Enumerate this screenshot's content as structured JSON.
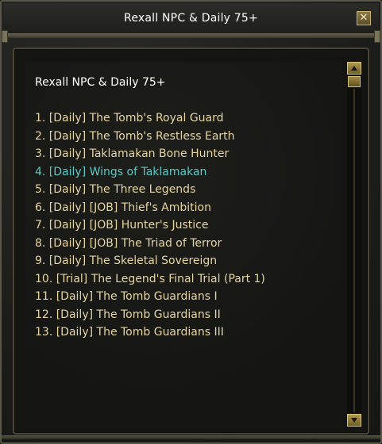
{
  "window": {
    "title": "Rexall NPC & Daily 75+",
    "close_label": "✕"
  },
  "content": {
    "heading": "Rexall NPC & Daily 75+",
    "quests": [
      {
        "label": "1. [Daily] The Tomb's Royal Guard",
        "active": false
      },
      {
        "label": "2. [Daily] The Tomb's Restless Earth",
        "active": false
      },
      {
        "label": "3. [Daily] Taklamakan Bone Hunter",
        "active": false
      },
      {
        "label": "4. [Daily] Wings of Taklamakan",
        "active": true
      },
      {
        "label": "5. [Daily] The Three Legends",
        "active": false
      },
      {
        "label": "6. [Daily] [JOB] Thief's Ambition",
        "active": false
      },
      {
        "label": "7. [Daily] [JOB] Hunter's Justice",
        "active": false
      },
      {
        "label": "8. [Daily] [JOB] The Triad of Terror",
        "active": false
      },
      {
        "label": "9. [Daily] The Skeletal Sovereign",
        "active": false
      },
      {
        "label": "10. [Trial] The Legend's Final Trial (Part 1)",
        "active": false
      },
      {
        "label": "11. [Daily] The Tomb Guardians I",
        "active": false
      },
      {
        "label": "12. [Daily] The Tomb Guardians II",
        "active": false
      },
      {
        "label": "13. [Daily] The Tomb Guardians III",
        "active": false
      }
    ]
  },
  "colors": {
    "quest_text": "#e6d5a4",
    "quest_active": "#5ec8c4",
    "title_text": "#ffffff",
    "frame_gold": "#d8c27a"
  },
  "icons": {
    "close": "close-icon",
    "scroll_up": "arrow-up-icon",
    "scroll_down": "arrow-down-icon"
  }
}
